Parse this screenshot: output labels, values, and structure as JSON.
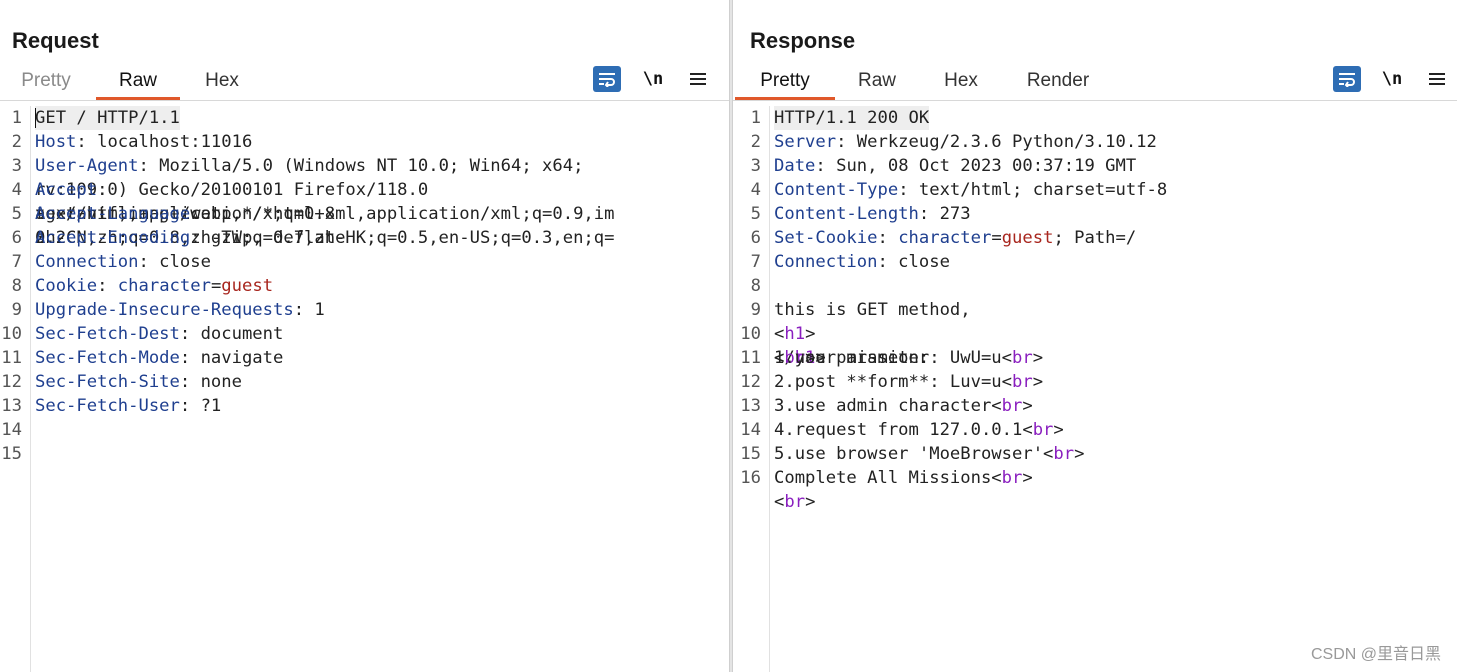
{
  "request": {
    "title": "Request",
    "tabs": [
      "Pretty",
      "Raw",
      "Hex"
    ],
    "active_tab": "Raw",
    "newline_toggle": "\\n",
    "line_numbers": [
      "1",
      "2",
      "3",
      "",
      "4",
      "",
      "",
      "5",
      "",
      "",
      "6",
      "7",
      "8",
      "9",
      "10",
      "11",
      "12",
      "13",
      "14",
      "15"
    ],
    "lines": [
      {
        "v": "GET / HTTP/1.1"
      },
      {
        "k": "Host",
        "v": ": localhost:11016"
      },
      {
        "k": "User-Agent",
        "v": ": Mozilla/5.0 (Windows NT 10.0; Win64; x64;"
      },
      {
        "v": "rv:109.0) Gecko/20100101 Firefox/118.0"
      },
      {
        "k": "Accept",
        "v": ":"
      },
      {
        "v": "text/html,application/xhtml+xml,application/xml;q=0.9,im"
      },
      {
        "v": "age/avif,image/webp,*/*;q=0.8"
      },
      {
        "k": "Accept-Language",
        "v": ":"
      },
      {
        "v": "zh-CN,zh;q=0.8,zh-TW;q=0.7,zh-HK;q=0.5,en-US;q=0.3,en;q="
      },
      {
        "v": "0.2"
      },
      {
        "k": "Accept-Encoding",
        "v": ": gzip, deflate"
      },
      {
        "k": "Connection",
        "v": ": close"
      },
      {
        "k": "Cookie",
        "v": ": ",
        "k2": "character",
        "v2": "=",
        "r": "guest"
      },
      {
        "k": "Upgrade-Insecure-Requests",
        "v": ": 1"
      },
      {
        "k": "Sec-Fetch-Dest",
        "v": ": document"
      },
      {
        "k": "Sec-Fetch-Mode",
        "v": ": navigate"
      },
      {
        "k": "Sec-Fetch-Site",
        "v": ": none"
      },
      {
        "k": "Sec-Fetch-User",
        "v": ": ?1"
      },
      {
        "v": ""
      },
      {
        "v": ""
      }
    ]
  },
  "response": {
    "title": "Response",
    "tabs": [
      "Pretty",
      "Raw",
      "Hex",
      "Render"
    ],
    "active_tab": "Pretty",
    "newline_toggle": "\\n",
    "line_numbers": [
      "1",
      "2",
      "3",
      "4",
      "5",
      "6",
      "7",
      "8",
      "9",
      "10",
      "",
      "",
      "",
      "11",
      "12",
      "13",
      "14",
      "15",
      "16",
      ""
    ],
    "lines": [
      {
        "v": "HTTP/1.1 200 OK"
      },
      {
        "k": "Server",
        "v": ": Werkzeug/2.3.6 Python/3.10.12"
      },
      {
        "k": "Date",
        "v": ": Sun, 08 Oct 2023 00:37:19 GMT"
      },
      {
        "k": "Content-Type",
        "v": ": text/html; charset=utf-8"
      },
      {
        "k": "Content-Length",
        "v": ": 273"
      },
      {
        "k": "Set-Cookie",
        "v": ": ",
        "k2": "character",
        "v2": "=",
        "r": "guest",
        "v3": "; Path=/"
      },
      {
        "k": "Connection",
        "v": ": close"
      },
      {
        "v": ""
      },
      {
        "v": "this is GET method,"
      },
      {
        "v": "<",
        "t": "h1",
        "v2": ">"
      },
      {
        "v": "  your mission:"
      },
      {
        "v": "</",
        "t": "h1",
        "v2": ">"
      },
      {
        "v": "<",
        "t": "br",
        "v2": ">"
      },
      {
        "v": "1.use parameter: UwU=u<",
        "t": "br",
        "v2": ">"
      },
      {
        "v": "2.post **form**: Luv=u<",
        "t": "br",
        "v2": ">"
      },
      {
        "v": "3.use admin character<",
        "t": "br",
        "v2": ">"
      },
      {
        "v": "4.request from 127.0.0.1<",
        "t": "br",
        "v2": ">"
      },
      {
        "v": "5.use browser 'MoeBrowser'<",
        "t": "br",
        "v2": ">"
      },
      {
        "v": "Complete All Missions<",
        "t": "br",
        "v2": ">"
      },
      {
        "v": "<",
        "t": "br",
        "v2": ">"
      }
    ]
  },
  "watermark": "CSDN @里音日黑",
  "colors": {
    "accent": "#e0582a",
    "toggle_blue": "#2e6db4",
    "header_key": "#1f3f8f",
    "tag": "#8a1fbf",
    "cookie_value": "#a8261e"
  }
}
